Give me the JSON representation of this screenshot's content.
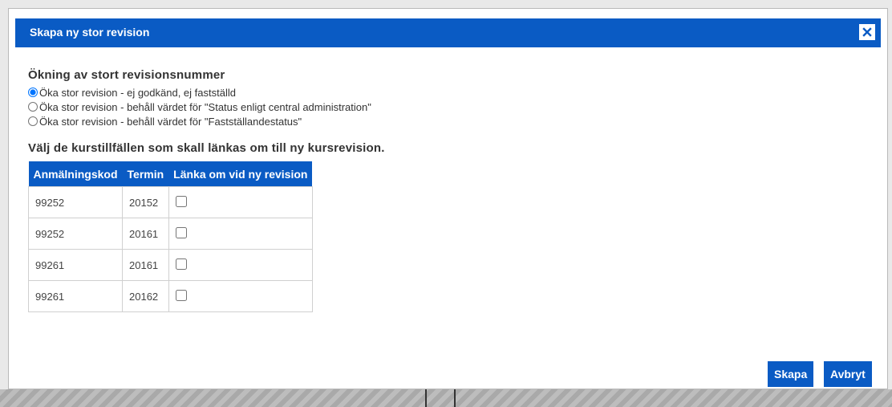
{
  "dialog": {
    "title": "Skapa ny stor revision",
    "close_icon": "close-icon"
  },
  "revision": {
    "heading": "Ökning av stort revisionsnummer",
    "options": [
      {
        "label": "Öka stor revision - ej godkänd, ej fastställd",
        "selected": true
      },
      {
        "label": "Öka stor revision - behåll värdet för \"Status enligt central administration\"",
        "selected": false
      },
      {
        "label": "Öka stor revision - behåll värdet för \"Fastställandestatus\"",
        "selected": false
      }
    ]
  },
  "link_section": {
    "heading": "Välj de kurstillfällen som skall länkas om till ny kursrevision.",
    "columns": [
      "Anmälningskod",
      "Termin",
      "Länka om vid ny revision"
    ],
    "rows": [
      {
        "code": "99252",
        "term": "20152",
        "checked": false
      },
      {
        "code": "99252",
        "term": "20161",
        "checked": false
      },
      {
        "code": "99261",
        "term": "20161",
        "checked": false
      },
      {
        "code": "99261",
        "term": "20162",
        "checked": false
      }
    ]
  },
  "buttons": {
    "create": "Skapa",
    "cancel": "Avbryt"
  },
  "colors": {
    "accent": "#0a5bc4"
  }
}
